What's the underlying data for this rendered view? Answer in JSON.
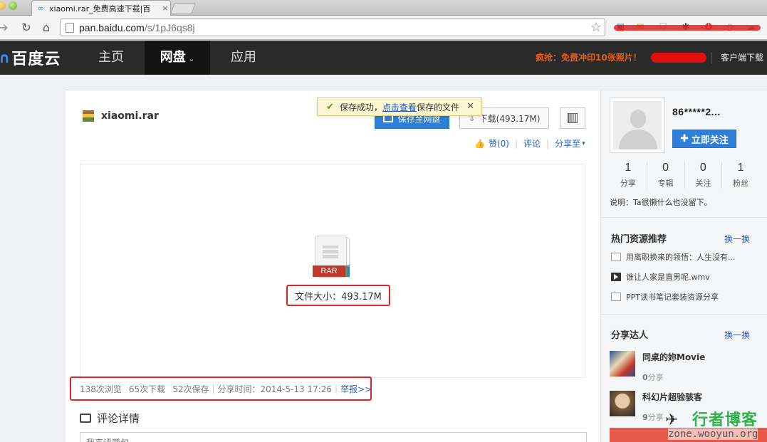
{
  "browser": {
    "tab_title": "xiaomi.rar_免费高速下载|百",
    "tab_close": "×",
    "url_host": "pan.baidu.com",
    "url_path": "/s/1pJ6qs8j",
    "star": "☆",
    "icons": [
      "back-arrow-icon",
      "reload-icon",
      "home-icon",
      "page-icon",
      "star-icon"
    ]
  },
  "sitenav": {
    "logo_mark": "∩",
    "logo_text": "百度云",
    "home": "主页",
    "pan": "网盘",
    "pan_caret": "⌄",
    "app": "应用",
    "promo": "疯抢：免费冲印10张照片！",
    "client_download": "客户端下载"
  },
  "file": {
    "name": "xiaomi.rar",
    "save_button": "保存至网盘",
    "download_button": "下载(493.17M)",
    "type_label": "RAR",
    "size_text": "文件大小：493.17M"
  },
  "toast": {
    "prefix": "保存成功，",
    "link": "点击查看",
    "suffix": "保存的文件",
    "close": "✕"
  },
  "social": {
    "like": "赞(0)",
    "comment": "评论",
    "share": "分享至"
  },
  "stats": {
    "views": "138次浏览",
    "downloads": "65次下载",
    "saves": "52次保存",
    "share_time": "分享时间：2014-5-13 17:26",
    "report": "举报>>"
  },
  "comments": {
    "title": "评论详情",
    "placeholder": "我来评两句~"
  },
  "sidebar": {
    "username": "86*****2...",
    "follow_button": "立即关注",
    "counts": [
      {
        "num": "1",
        "label": "分享"
      },
      {
        "num": "0",
        "label": "专辑"
      },
      {
        "num": "0",
        "label": "关注"
      },
      {
        "num": "1",
        "label": "粉丝"
      }
    ],
    "description": "说明：Ta很懒什么也没留下。",
    "hot_title": "热门资源推荐",
    "hot_more": "换一换",
    "hot_items": [
      {
        "text": "用离职换来的领悟：人生没有...",
        "icon": "doc-icon"
      },
      {
        "text": "谁让人家是直男呢.wmv",
        "icon": "video-icon"
      },
      {
        "text": "PPT读书笔记套装资源分享",
        "icon": "doc-icon"
      }
    ],
    "talent_title": "分享达人",
    "talent_more": "换一换",
    "talents": [
      {
        "name": "同桌的妳Movie",
        "count": "0",
        "share_label": "分享"
      },
      {
        "name": "科幻片超验骇客",
        "count": "9",
        "share_label": "分享"
      }
    ]
  },
  "watermark": {
    "brand": "行者博客",
    "url": "zone.wooyun.org"
  },
  "colors": {
    "accent_blue": "#2f7fd8",
    "nav_bg": "#2a2a2a",
    "promo": "#e7601a",
    "highlight_red": "#e02222",
    "toast_bg": "#fdf6d3"
  }
}
